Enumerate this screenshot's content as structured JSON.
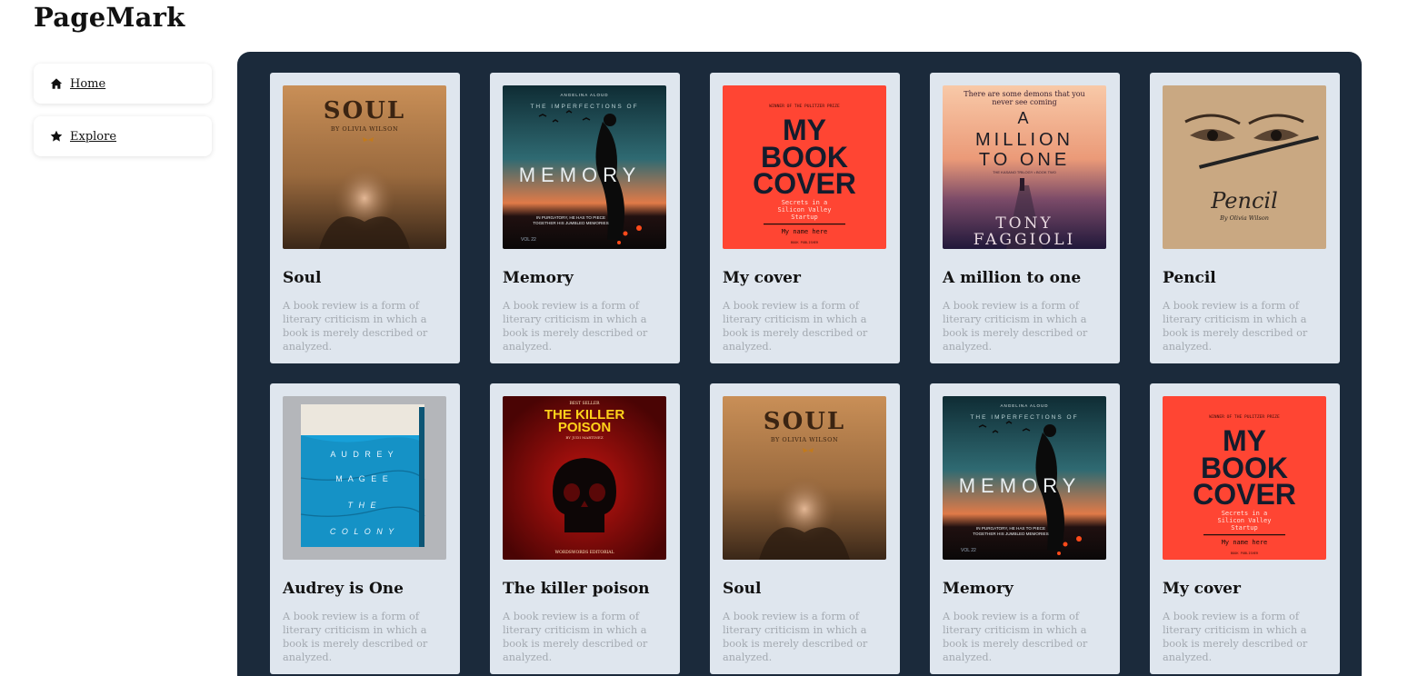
{
  "app": {
    "title": "PageMark"
  },
  "nav": [
    {
      "label": "Home",
      "icon": "home-icon"
    },
    {
      "label": "Explore",
      "icon": "star-icon"
    }
  ],
  "books": [
    {
      "title": "Soul",
      "description": "A book review is a form of literary criticism in which a book is merely described or analyzed.",
      "cover": "soul"
    },
    {
      "title": "Memory",
      "description": "A book review is a form of literary criticism in which a book is merely described or analyzed.",
      "cover": "memory"
    },
    {
      "title": "My cover",
      "description": "A book review is a form of literary criticism in which a book is merely described or analyzed.",
      "cover": "mycover"
    },
    {
      "title": "A million to one",
      "description": "A book review is a form of literary criticism in which a book is merely described or analyzed.",
      "cover": "million"
    },
    {
      "title": "Pencil",
      "description": "A book review is a form of literary criticism in which a book is merely described or analyzed.",
      "cover": "pencil"
    },
    {
      "title": "Audrey is One",
      "description": "A book review is a form of literary criticism in which a book is merely described or analyzed.",
      "cover": "audrey"
    },
    {
      "title": "The killer poison",
      "description": "A book review is a form of literary criticism in which a book is merely described or analyzed.",
      "cover": "killer"
    },
    {
      "title": "Soul",
      "description": "A book review is a form of literary criticism in which a book is merely described or analyzed.",
      "cover": "soul"
    },
    {
      "title": "Memory",
      "description": "A book review is a form of literary criticism in which a book is merely described or analyzed.",
      "cover": "memory"
    },
    {
      "title": "My cover",
      "description": "A book review is a form of literary criticism in which a book is merely described or analyzed.",
      "cover": "mycover"
    }
  ],
  "covers": {
    "soul": {
      "title": "SOUL",
      "author": "BY OLIVIA WILSON"
    },
    "memory": {
      "top": "ANGELINA ALOUD",
      "sub": "THE IMPERFECTIONS OF",
      "title": "MEMORY",
      "line1": "IN PURGATORY, HE HAS TO PIECE",
      "line2": "TOGETHER HIS JUMBLED MEMORIES",
      "vol": "VOL 22"
    },
    "mycover": {
      "prize": "WINNER OF THE PULITZER PRIZE",
      "t1": "MY",
      "t2": "BOOK",
      "t3": "COVER",
      "s1": "Secrets in a",
      "s2": "Silicon Valley",
      "s3": "Startup",
      "name": "My name here",
      "pub": "BOOK PUBLISHER"
    },
    "million": {
      "q1": "There are some demons that you",
      "q2": "never see coming",
      "t1": "A",
      "t2": "MILLION",
      "t3": "TO ONE",
      "series": "THE KASANO TRILOGY • BOOK TWO",
      "a1": "TONY",
      "a2": "FAGGIOLI"
    },
    "pencil": {
      "title": "Pencil",
      "author": "By Olivia Wilson"
    },
    "audrey": {
      "l1": "A U D R E Y",
      "l2": "M A G E E",
      "l3": "T H E",
      "l4": "C O L O N Y"
    },
    "killer": {
      "top": "BEST SELLER",
      "t1": "THE KILLER",
      "t2": "POISON",
      "author": "BY JUDI MARTINEZ",
      "pub": "WORDSWORDS EDITORIAL"
    }
  }
}
